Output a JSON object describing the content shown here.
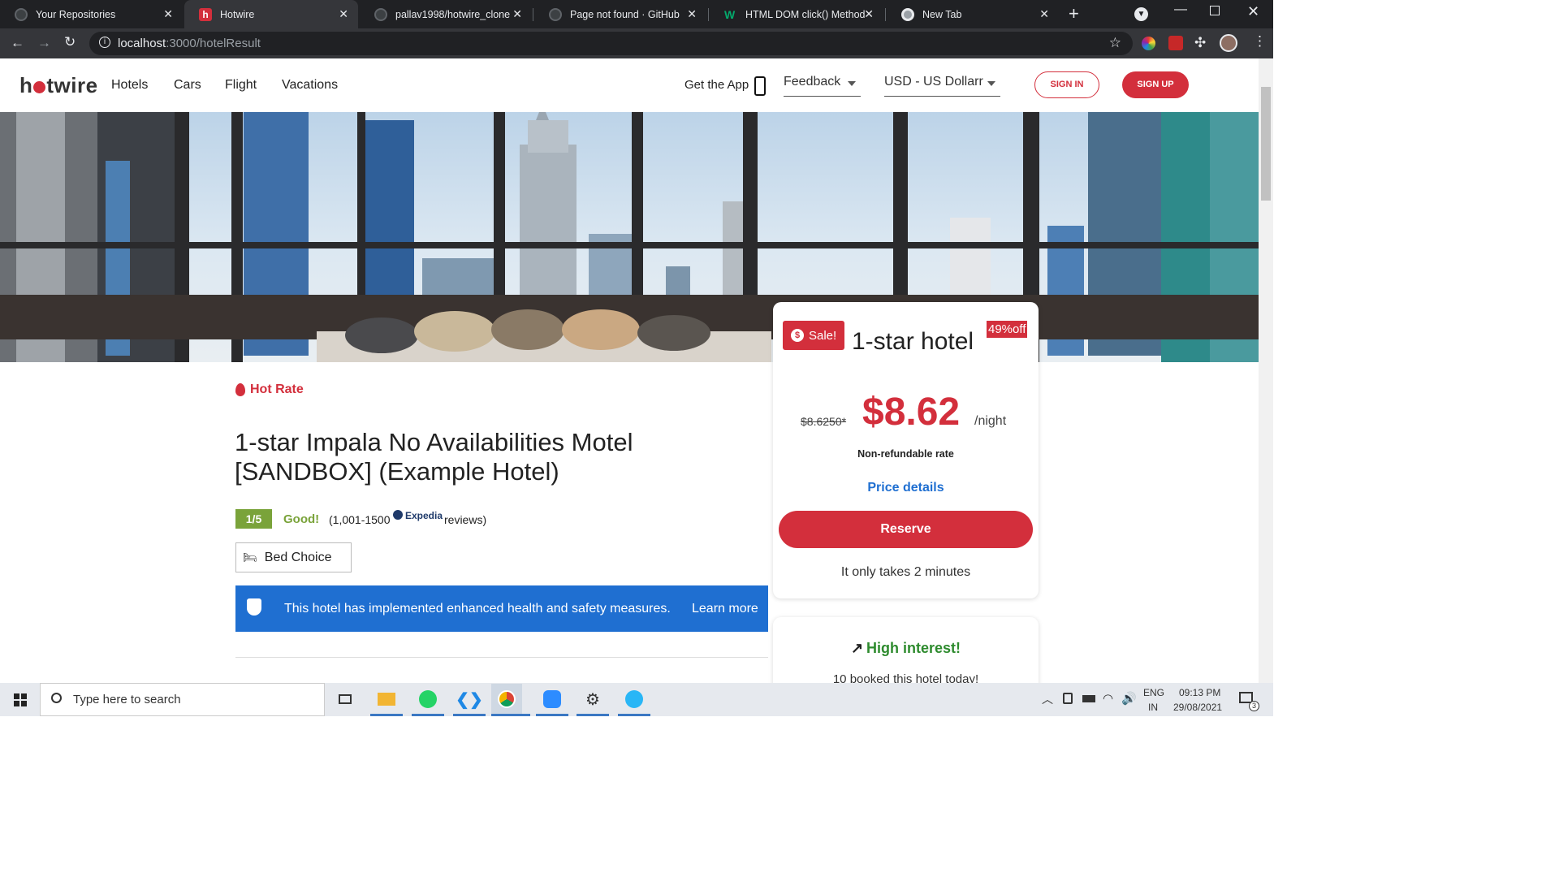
{
  "browser": {
    "tabs": [
      {
        "title": "Your Repositories",
        "favicon_color": "#5f6368",
        "active": false
      },
      {
        "title": "Hotwire",
        "favicon_color": "#d32f3c",
        "active": true
      },
      {
        "title": "pallav1998/hotwire_clone",
        "favicon_color": "#5f6368",
        "active": false
      },
      {
        "title": "Page not found · GitHub",
        "favicon_color": "#5f6368",
        "active": false
      },
      {
        "title": "HTML DOM click() Method",
        "favicon_color": "#04aa6d",
        "active": false
      },
      {
        "title": "New Tab",
        "favicon_color": "#9aa0a6",
        "active": false
      }
    ],
    "url_host": "localhost",
    "url_rest": ":3000/hotelResult"
  },
  "site": {
    "logo": "hotwire",
    "nav": [
      "Hotels",
      "Cars",
      "Flight",
      "Vacations"
    ],
    "get_app": "Get the App",
    "feedback": "Feedback",
    "currency": "USD - US Dollarr",
    "sign_in": "SIGN IN",
    "sign_up": "SIGN UP"
  },
  "hotel": {
    "hot_rate": "Hot Rate",
    "name_line1": "1-star Impala No Availabilities Motel",
    "name_line2": "[SANDBOX] (Example Hotel)",
    "score": "1/5",
    "score_word": "Good!",
    "reviews_prefix": "(1,001-1500",
    "reviews_source": "Expedia",
    "reviews_suffix": "reviews)",
    "bed_choice": "Bed Choice",
    "safety_text": "This hotel has implemented enhanced health and safety measures.",
    "learn_more": "Learn more"
  },
  "booking": {
    "sale_badge": "Sale!",
    "title": "1-star hotel",
    "discount": "49%off",
    "old_price": "$8.6250*",
    "price": "$8.62",
    "per": "/night",
    "refund": "Non-refundable rate",
    "price_details": "Price details",
    "reserve": "Reserve",
    "takes": "It only takes 2 minutes",
    "interest_title": "High interest!",
    "interest_text": "10 booked this hotel today!"
  },
  "taskbar": {
    "search_placeholder": "Type here to search",
    "lang_top": "ENG",
    "lang_bottom": "IN",
    "time": "09:13 PM",
    "date": "29/08/2021",
    "notif_count": "3"
  },
  "colors": {
    "brand_red": "#d32f3c",
    "safety_blue": "#1f6fd1",
    "score_green": "#7aa33a",
    "link_blue": "#1f6fd1",
    "high_interest_green": "#2e8b2e"
  }
}
